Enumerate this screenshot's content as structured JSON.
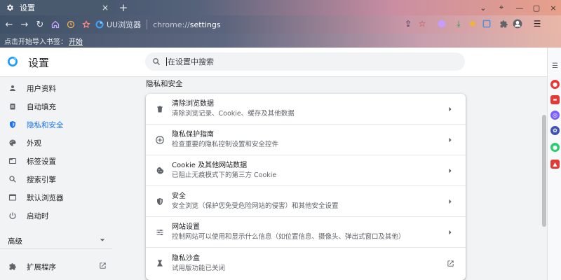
{
  "tab": {
    "title": "设置",
    "close_glyph": "×"
  },
  "newtab": {
    "glyph": "+"
  },
  "window": {
    "min": "⌄",
    "pin": "⌖",
    "minimize": "—",
    "maximize": "▢",
    "close": "×"
  },
  "nav": {
    "back": "←",
    "forward": "→",
    "reload": "↻"
  },
  "omnibox": {
    "brand": "UU浏览器",
    "url_scheme": "chrome://",
    "url_host": "settings"
  },
  "bookmarks": {
    "prompt": "点击开始导入书签：",
    "link": "开始"
  },
  "header": {
    "title": "设置",
    "search_placeholder": "在设置中搜索"
  },
  "sidebar": {
    "items": [
      {
        "label": "用户资料",
        "icon": "person-icon"
      },
      {
        "label": "自动填充",
        "icon": "clipboard-icon"
      },
      {
        "label": "隐私和安全",
        "icon": "shield-icon",
        "active": true
      },
      {
        "label": "外观",
        "icon": "palette-icon"
      },
      {
        "label": "标签设置",
        "icon": "tab-icon"
      },
      {
        "label": "搜索引擎",
        "icon": "search-icon"
      },
      {
        "label": "默认浏览器",
        "icon": "browser-icon"
      },
      {
        "label": "启动时",
        "icon": "power-icon"
      }
    ],
    "advanced": "高级",
    "extensions": "扩展程序"
  },
  "privacy": {
    "section_title": "隐私和安全",
    "rows": [
      {
        "title": "清除浏览数据",
        "subtitle": "清除浏览记录、Cookie、缓存及其他数据",
        "icon": "trash-icon",
        "action": "arrow"
      },
      {
        "title": "隐私保护指南",
        "subtitle": "检查重要的隐私控制设置和安全控件",
        "icon": "compass-icon",
        "action": "arrow"
      },
      {
        "title": "Cookie 及其他网站数据",
        "subtitle": "已阻止无痕模式下的第三方 Cookie",
        "icon": "cookie-icon",
        "action": "arrow"
      },
      {
        "title": "安全",
        "subtitle": "安全浏览（保护您免受危险网站的侵害）和其他安全设置",
        "icon": "shield-icon",
        "action": "arrow"
      },
      {
        "title": "网站设置",
        "subtitle": "控制网站可以使用和显示什么信息（如位置信息、摄像头、弹出式窗口及其他）",
        "icon": "sliders-icon",
        "action": "arrow"
      },
      {
        "title": "隐私沙盒",
        "subtitle": "试用版功能已关闭",
        "icon": "flask-icon",
        "action": "external"
      }
    ]
  },
  "colors": {
    "accent": "#1a73e8",
    "text": "#202124",
    "subtext": "#5f6368"
  }
}
